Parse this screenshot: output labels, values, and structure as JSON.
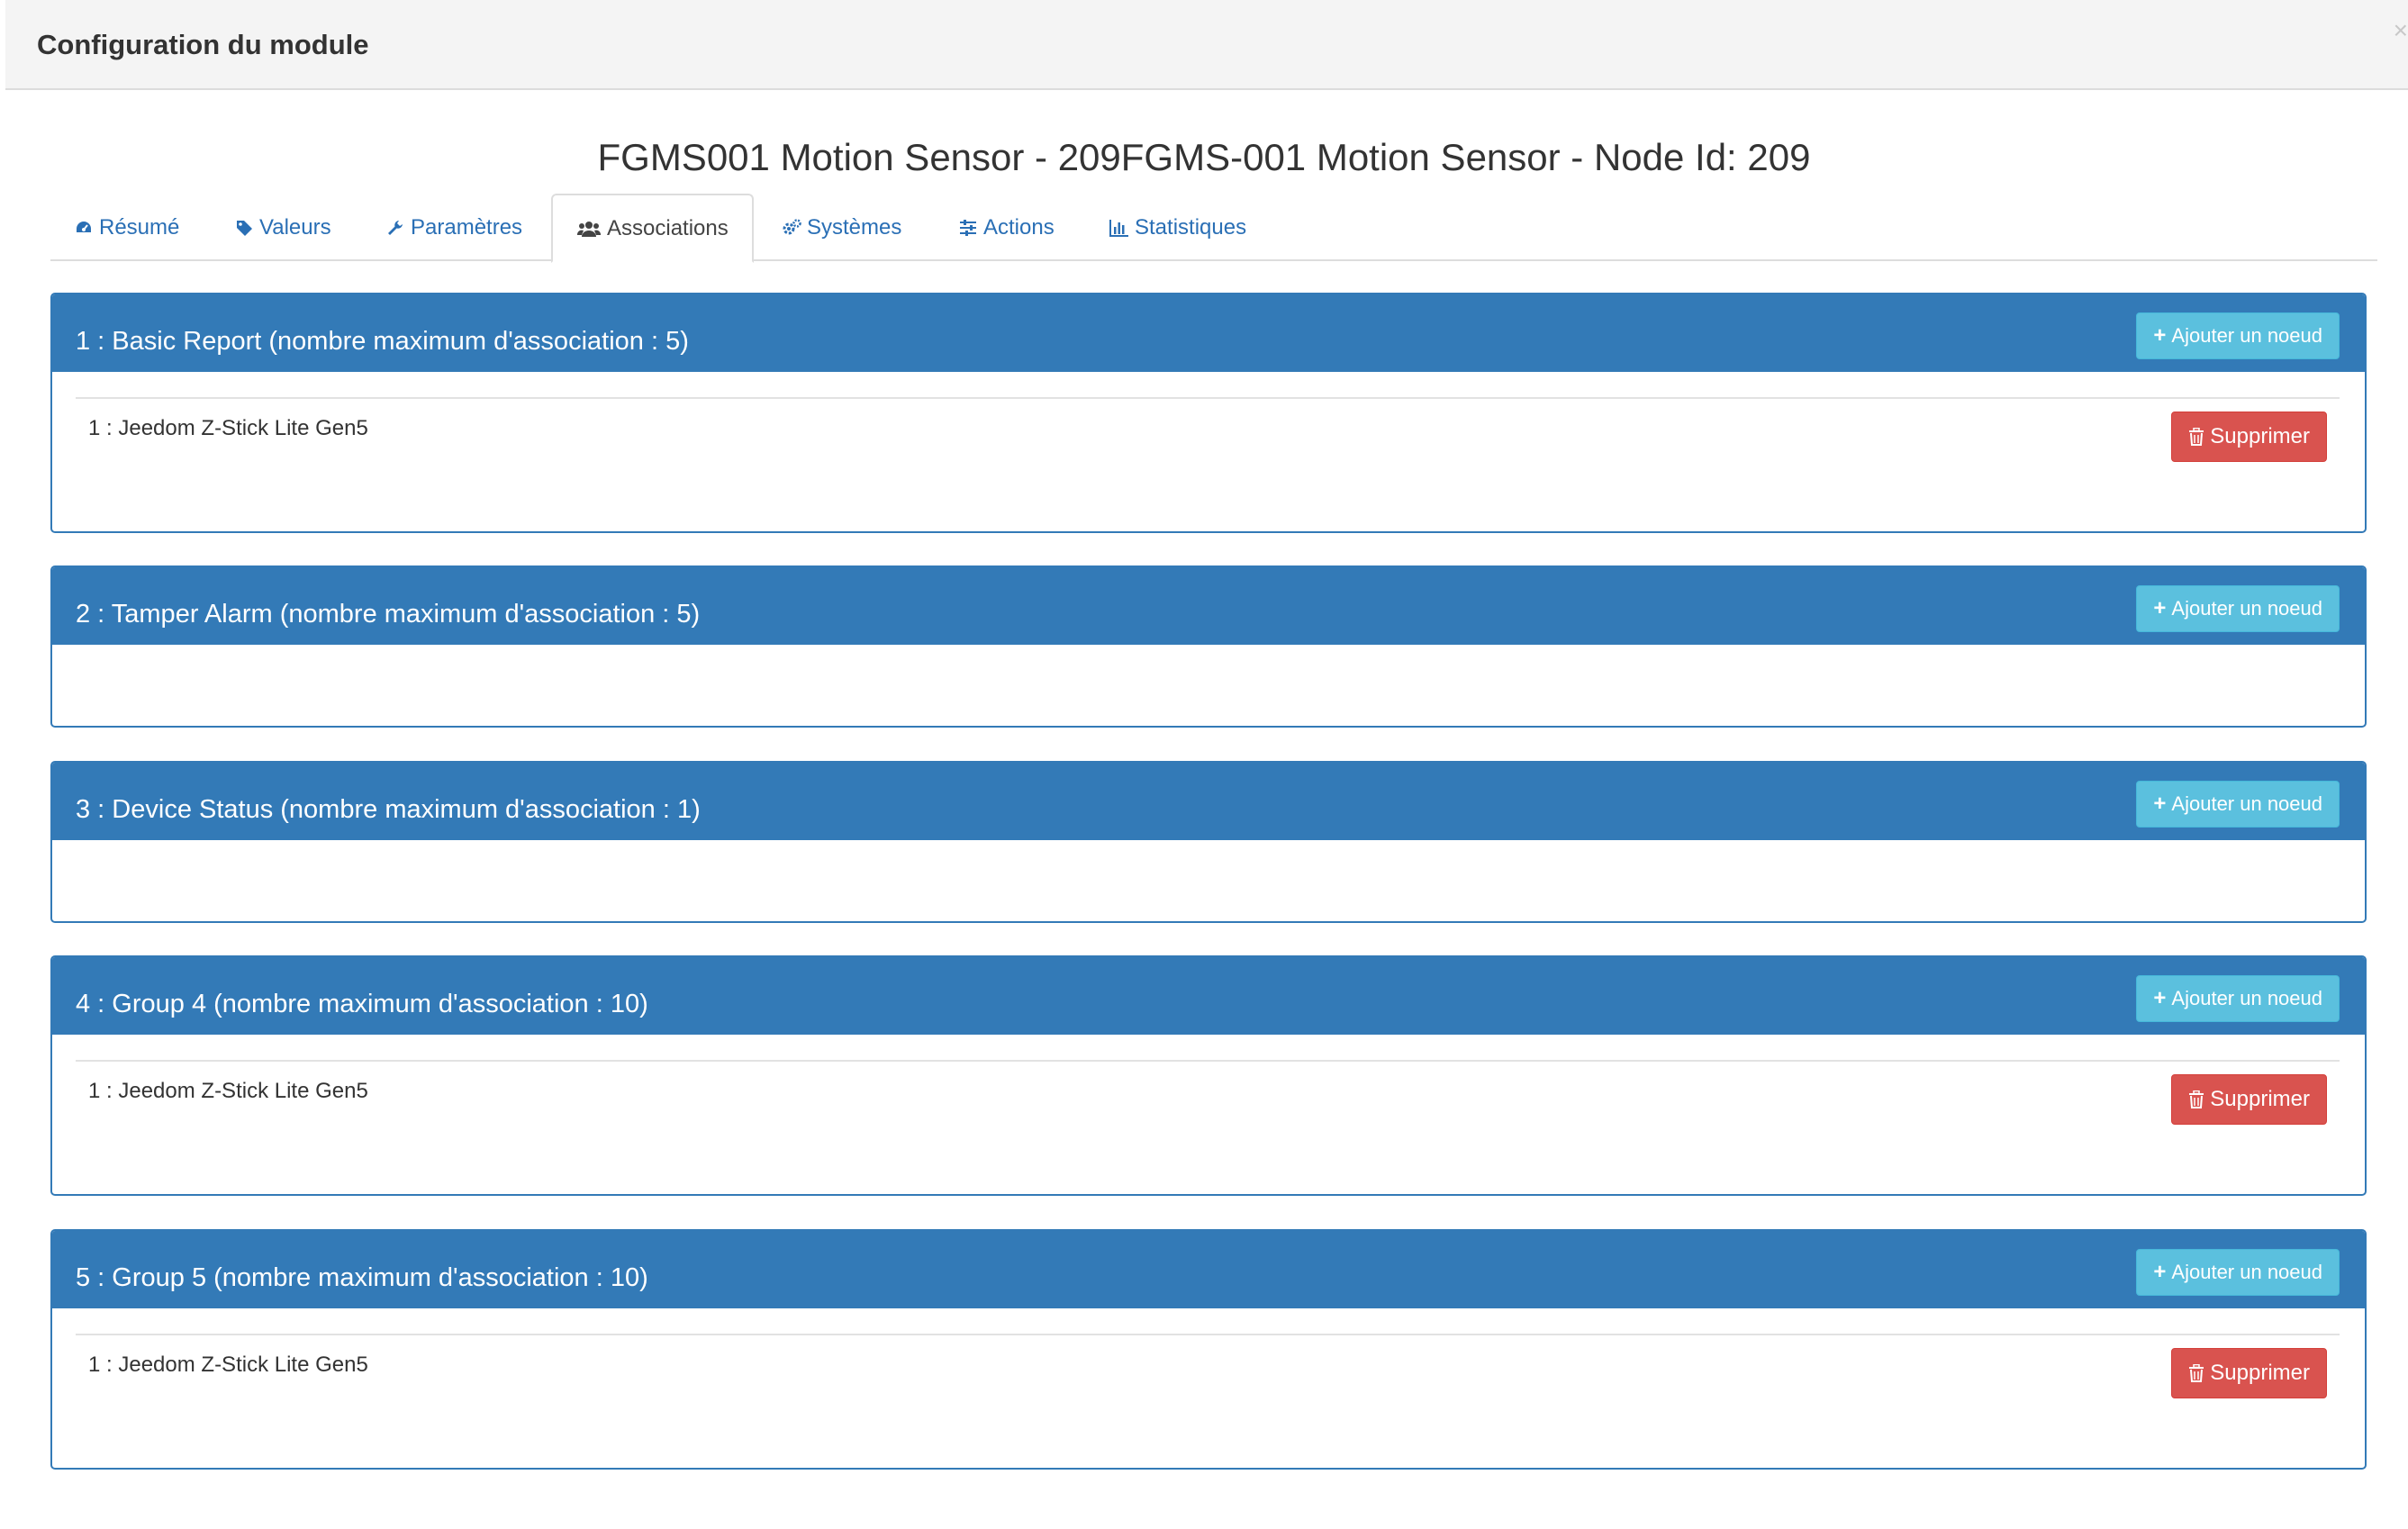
{
  "modal": {
    "title": "Configuration du module",
    "close_label": "×"
  },
  "page": {
    "title": "FGMS001 Motion Sensor - 209FGMS-001 Motion Sensor - Node Id: 209"
  },
  "tabs": [
    {
      "label": "Résumé",
      "icon": "dashboard-icon",
      "active": false
    },
    {
      "label": "Valeurs",
      "icon": "tag-icon",
      "active": false
    },
    {
      "label": "Paramètres",
      "icon": "wrench-icon",
      "active": false
    },
    {
      "label": "Associations",
      "icon": "users-icon",
      "active": true
    },
    {
      "label": "Systèmes",
      "icon": "gears-icon",
      "active": false
    },
    {
      "label": "Actions",
      "icon": "sliders-icon",
      "active": false
    },
    {
      "label": "Statistiques",
      "icon": "bar-chart-icon",
      "active": false
    }
  ],
  "labels": {
    "add_node": "Ajouter un noeud",
    "delete": "Supprimer"
  },
  "groups": [
    {
      "title": "1 : Basic Report (nombre maximum d'association : 5)",
      "nodes": [
        "1 : Jeedom Z-Stick Lite Gen5"
      ]
    },
    {
      "title": "2 : Tamper Alarm (nombre maximum d'association : 5)",
      "nodes": []
    },
    {
      "title": "3 : Device Status (nombre maximum d'association : 1)",
      "nodes": []
    },
    {
      "title": "4 : Group 4 (nombre maximum d'association : 10)",
      "nodes": [
        "1 : Jeedom Z-Stick Lite Gen5"
      ]
    },
    {
      "title": "5 : Group 5 (nombre maximum d'association : 10)",
      "nodes": [
        "1 : Jeedom Z-Stick Lite Gen5"
      ]
    }
  ],
  "colors": {
    "panel_primary": "#337ab7",
    "button_info": "#5bc0de",
    "button_danger": "#d9534f",
    "tab_link": "#2a6fb5"
  }
}
